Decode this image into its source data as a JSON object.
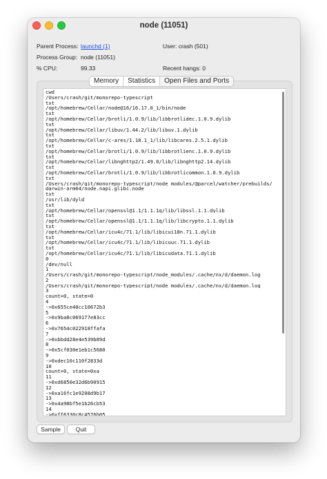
{
  "window": {
    "title": "node (11051)"
  },
  "info": {
    "parent_process_label": "Parent Process:",
    "parent_process_value": "launchd (1)",
    "user_label": "User:",
    "user_value": "crash (501)",
    "process_group_label": "Process Group:",
    "process_group_value": "node (11051)",
    "cpu_label": "% CPU:",
    "cpu_value": "99.33",
    "recent_hangs_label": "Recent hangs:",
    "recent_hangs_value": "0"
  },
  "tabs": [
    {
      "label": "Memory"
    },
    {
      "label": "Statistics"
    },
    {
      "label": "Open Files and Ports"
    }
  ],
  "selected_tab": "Open Files and Ports",
  "lines": [
    "cwd",
    "/Users/crash/git/monorepo-typescript",
    "txt",
    "/opt/homebrew/Cellar/node@16/16.17.0_1/bin/node",
    "txt",
    "/opt/homebrew/Cellar/brotli/1.0.9/lib/libbrotlidec.1.0.9.dylib",
    "txt",
    "/opt/homebrew/Cellar/libuv/1.44.2/lib/libuv.1.dylib",
    "txt",
    "/opt/homebrew/Cellar/c-ares/1.18.1_1/lib/libcares.2.5.1.dylib",
    "txt",
    "/opt/homebrew/Cellar/brotli/1.0.9/lib/libbrotlienc.1.0.9.dylib",
    "txt",
    "/opt/homebrew/Cellar/libnghttp2/1.49.0/lib/libnghttp2.14.dylib",
    "txt",
    "/opt/homebrew/Cellar/brotli/1.0.9/lib/libbrotlicommon.1.0.9.dylib",
    "txt",
    "/Users/crash/git/monorepo-typescript/node_modules/@parcel/watcher/prebuilds/",
    "darwin-arm64/node.napi.glibc.node",
    "txt",
    "/usr/lib/dyld",
    "txt",
    "/opt/homebrew/Cellar/openssl@1.1/1.1.1q/lib/libssl.1.1.dylib",
    "txt",
    "/opt/homebrew/Cellar/openssl@1.1/1.1.1q/lib/libcrypto.1.1.dylib",
    "txt",
    "/opt/homebrew/Cellar/icu4c/71.1/lib/libicui18n.71.1.dylib",
    "txt",
    "/opt/homebrew/Cellar/icu4c/71.1/lib/libicuuc.71.1.dylib",
    "txt",
    "/opt/homebrew/Cellar/icu4c/71.1/lib/libicudata.71.1.dylib",
    "0",
    "/dev/null",
    "1",
    "/Users/crash/git/monorepo-typescript/node_modules/.cache/nx/d/daemon.log",
    "2",
    "/Users/crash/git/monorepo-typescript/node_modules/.cache/nx/d/daemon.log",
    "3",
    "count=0, state=0",
    "4",
    "->0x655ce40cc10672b3",
    "5",
    "->0x9ba8c069177e83cc",
    "6",
    "->0x7654c022918ffafa",
    "7",
    "->0xbbdd28e4e539b89d",
    "8",
    "->0x5cf030e1eb1c5680",
    "9",
    "->0xdec10c110f2833d",
    "10",
    "count=0, state=0xa",
    "11",
    "->0xd6850e32d6b90915",
    "12",
    "->0xa16fc1e9208d9b17",
    "13",
    "->0x4a98bf5e1b26cb53",
    "14",
    "->0xff6330c8c4576b05"
  ],
  "buttons": {
    "sample_label": "Sample",
    "quit_label": "Quit"
  }
}
